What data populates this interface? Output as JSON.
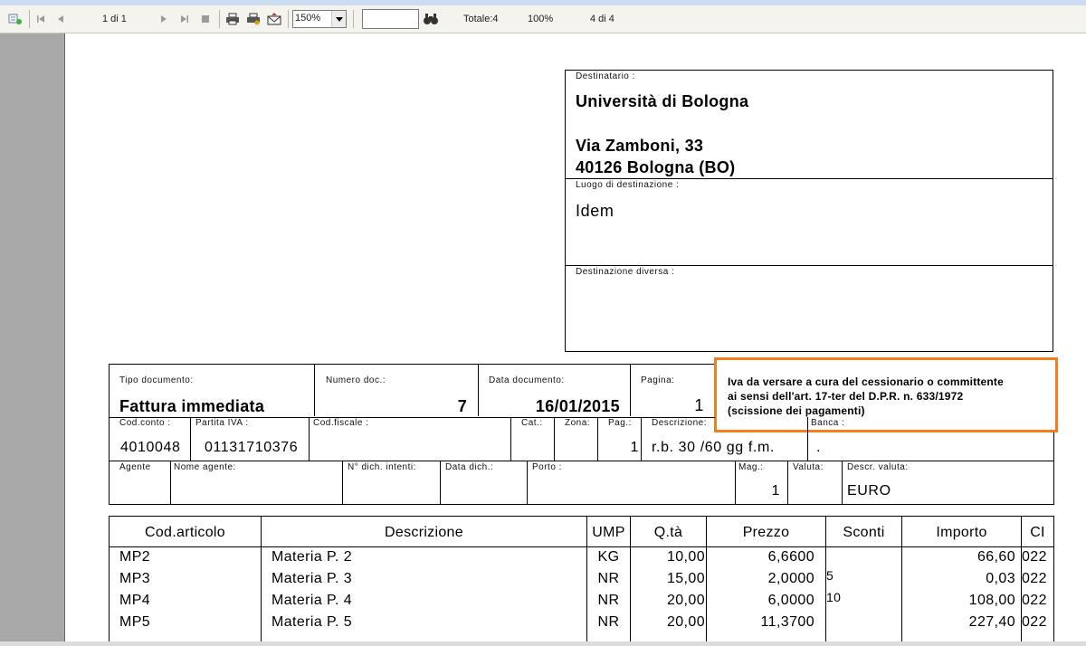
{
  "toolbar": {
    "page_indicator": "1 di 1",
    "zoom": "150%",
    "find_value": "",
    "total": "Totale:4",
    "percent": "100%",
    "count": "4 di 4",
    "icons": [
      "export-icon",
      "first-page-icon",
      "prev-page-icon",
      "next-page-icon",
      "last-page-icon",
      "stop-icon",
      "print-icon",
      "print-setup-icon",
      "email-icon",
      "find-icon"
    ]
  },
  "recipient": {
    "destinatario_label": "Destinatario :",
    "name": "Università di Bologna",
    "address": "Via Zamboni, 33",
    "city": "40126 Bologna (BO)",
    "luogo_label": "Luogo di destinazione :",
    "luogo_value": "Idem",
    "diversa_label": "Destinazione diversa :"
  },
  "doc": {
    "tipo_label": "Tipo documento:",
    "tipo_value": "Fattura immediata",
    "numero_label": "Numero doc.:",
    "numero_value": "7",
    "data_label": "Data documento:",
    "data_value": "16/01/2015",
    "pagina_label": "Pagina:",
    "pagina_value": "1"
  },
  "note": {
    "line1": "Iva da versare a cura del cessionario o committente",
    "line2": "ai sensi dell'art. 17-ter del D.P.R. n. 633/1972",
    "line3": "(scissione dei pagamenti)",
    "color": "#f07f22"
  },
  "row2": {
    "codconto_label": "Cod.conto :",
    "codconto_value": "4010048",
    "piva_label": "Partita IVA :",
    "piva_value": "01131710376",
    "codfiscale_label": "Cod.fiscale :",
    "cat_label": "Cat.:",
    "zona_label": "Zona:",
    "pag_label": "Pag.:",
    "pag_value": "1",
    "descrizione_label": "Descrizione:",
    "descrizione_value": "r.b. 30 /60 gg f.m.",
    "banca_label": "Banca :",
    "banca_value": "."
  },
  "row3": {
    "agente_label": "Agente",
    "nome_agente_label": "Nome agente:",
    "dich_label": "N° dich. intenti:",
    "data_dich_label": "Data dich.:",
    "porto_label": "Porto :",
    "mag_label": "Mag.:",
    "mag_value": "1",
    "valuta_label": "Valuta:",
    "descr_valuta_label": "Descr. valuta:",
    "descr_valuta_value": "EURO"
  },
  "table": {
    "headers": [
      "Cod.articolo",
      "Descrizione",
      "UMP",
      "Q.tà",
      "Prezzo",
      "Sconti",
      "Importo",
      "CI"
    ],
    "rows": [
      {
        "cod": "MP2",
        "descr": "Materia P. 2",
        "ump": "KG",
        "qta": "10,00",
        "prezzo": "6,6600",
        "sconti": "",
        "importo": "66,60",
        "ci": "022"
      },
      {
        "cod": "MP3",
        "descr": "Materia P. 3",
        "ump": "NR",
        "qta": "15,00",
        "prezzo": "2,0000",
        "sconti": "5",
        "importo": "0,03",
        "ci": "022"
      },
      {
        "cod": "MP4",
        "descr": "Materia P. 4",
        "ump": "NR",
        "qta": "20,00",
        "prezzo": "6,0000",
        "sconti": "10",
        "importo": "108,00",
        "ci": "022"
      },
      {
        "cod": "MP5",
        "descr": "Materia P. 5",
        "ump": "NR",
        "qta": "20,00",
        "prezzo": "11,3700",
        "sconti": "",
        "importo": "227,40",
        "ci": "022"
      }
    ]
  }
}
